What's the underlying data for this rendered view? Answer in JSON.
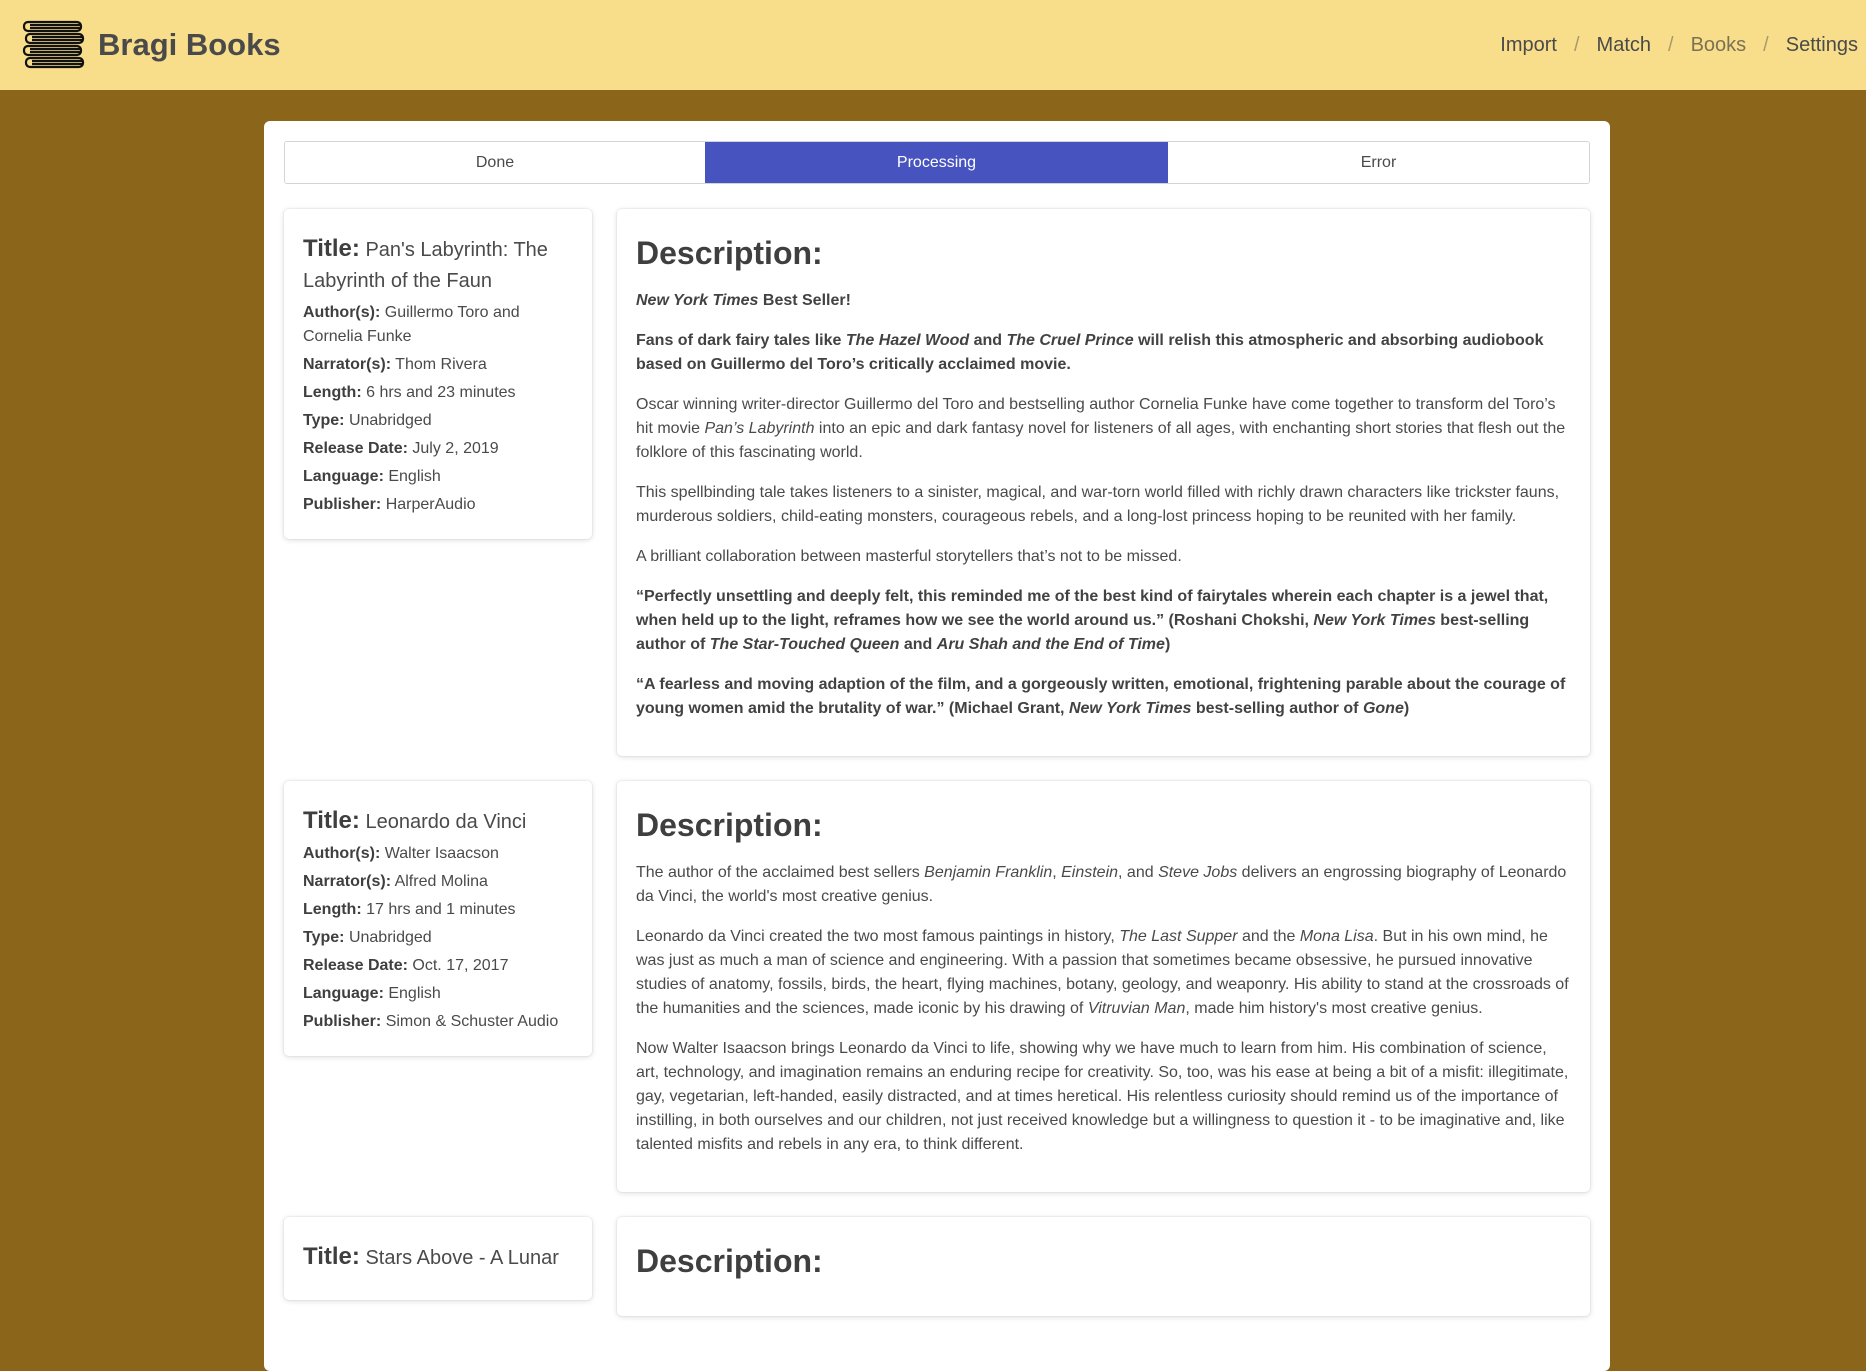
{
  "header": {
    "brand": "Bragi Books",
    "nav": {
      "import": "Import",
      "match": "Match",
      "books": "Books",
      "settings": "Settings",
      "separator": "/"
    }
  },
  "tabs": [
    "Done",
    "Processing",
    "Error"
  ],
  "labels": {
    "title": "Title:",
    "authors": "Author(s):",
    "narrators": "Narrator(s):",
    "length": "Length:",
    "type": "Type:",
    "release_date": "Release Date:",
    "language": "Language:",
    "publisher": "Publisher:",
    "description": "Description:"
  },
  "books": [
    {
      "title": "Pan's Labyrinth: The Labyrinth of the Faun",
      "authors": "Guillermo Toro and Cornelia Funke",
      "narrators": "Thom Rivera",
      "length": "6 hrs and 23 minutes",
      "type": "Unabridged",
      "release_date": "July 2, 2019",
      "language": "English",
      "publisher": "HarperAudio",
      "description": {
        "p1_em": "New York Times",
        "p1_rest": " Best Seller!",
        "p2_a": "Fans of dark fairy tales like ",
        "p2_em1": "The Hazel Wood",
        "p2_b": " and ",
        "p2_em2": "The Cruel Prince",
        "p2_c": " will relish this atmospheric and absorbing audiobook based on Guillermo del Toro’s critically acclaimed movie.",
        "p3_a": "Oscar winning writer-director Guillermo del Toro and bestselling author Cornelia Funke have come together to transform del Toro’s hit movie ",
        "p3_em": "Pan’s Labyrinth",
        "p3_b": " into an epic and dark fantasy novel for listeners of all ages, with enchanting short stories that flesh out the folklore of this fascinating world.",
        "p4": "This spellbinding tale takes listeners to a sinister, magical, and war-torn world filled with richly drawn characters like trickster fauns, murderous soldiers, child-eating monsters, courageous rebels, and a long-lost princess hoping to be reunited with her family.",
        "p5": "A brilliant collaboration between masterful storytellers that’s not to be missed.",
        "p6_a": "“Perfectly unsettling and deeply felt, this reminded me of the best kind of fairytales wherein each chapter is a jewel that, when held up to the light, reframes how we see the world around us.” (Roshani Chokshi, ",
        "p6_em1": "New York Times",
        "p6_b": " best-selling author of ",
        "p6_em2": "The Star-Touched Queen",
        "p6_c": " and ",
        "p6_em3": "Aru Shah and the End of Time",
        "p6_d": ")",
        "p7_a": "“A fearless and moving adaption of the film, and a gorgeously written, emotional, frightening parable about the courage of young women amid the brutality of war.”  (Michael Grant, ",
        "p7_em1": "New York Times",
        "p7_b": " best-selling author of ",
        "p7_em2": "Gone",
        "p7_c": ")"
      }
    },
    {
      "title": "Leonardo da Vinci",
      "authors": "Walter Isaacson",
      "narrators": "Alfred Molina",
      "length": "17 hrs and 1 minutes",
      "type": "Unabridged",
      "release_date": "Oct. 17, 2017",
      "language": "English",
      "publisher": "Simon & Schuster Audio",
      "description": {
        "p1_a": "The author of the acclaimed best sellers ",
        "p1_em1": "Benjamin Franklin",
        "p1_b": ", ",
        "p1_em2": "Einstein",
        "p1_c": ", and ",
        "p1_em3": "Steve Jobs",
        "p1_d": " delivers an engrossing biography of Leonardo da Vinci, the world's most creative genius.",
        "p2_a": "Leonardo da Vinci created the two most famous paintings in history, ",
        "p2_em1": "The Last Supper",
        "p2_b": " and the ",
        "p2_em2": "Mona Lisa",
        "p2_c": ". But in his own mind, he was just as much a man of science and engineering. With a passion that sometimes became obsessive, he pursued innovative studies of anatomy, fossils, birds, the heart, flying machines, botany, geology, and weaponry. His ability to stand at the crossroads of the humanities and the sciences, made iconic by his drawing of ",
        "p2_em3": "Vitruvian Man",
        "p2_d": ", made him history's most creative genius.",
        "p3": "Now Walter Isaacson brings Leonardo da Vinci to life, showing why we have much to learn from him. His combination of science, art, technology, and imagination remains an enduring recipe for creativity. So, too, was his ease at being a bit of a misfit: illegitimate, gay, vegetarian, left-handed, easily distracted, and at times heretical. His relentless curiosity should remind us of the importance of instilling, in both ourselves and our children, not just received knowledge but a willingness to question it - to be imaginative and, like talented misfits and rebels in any era, to think different."
      }
    },
    {
      "title": "Stars Above - A Lunar"
    }
  ]
}
